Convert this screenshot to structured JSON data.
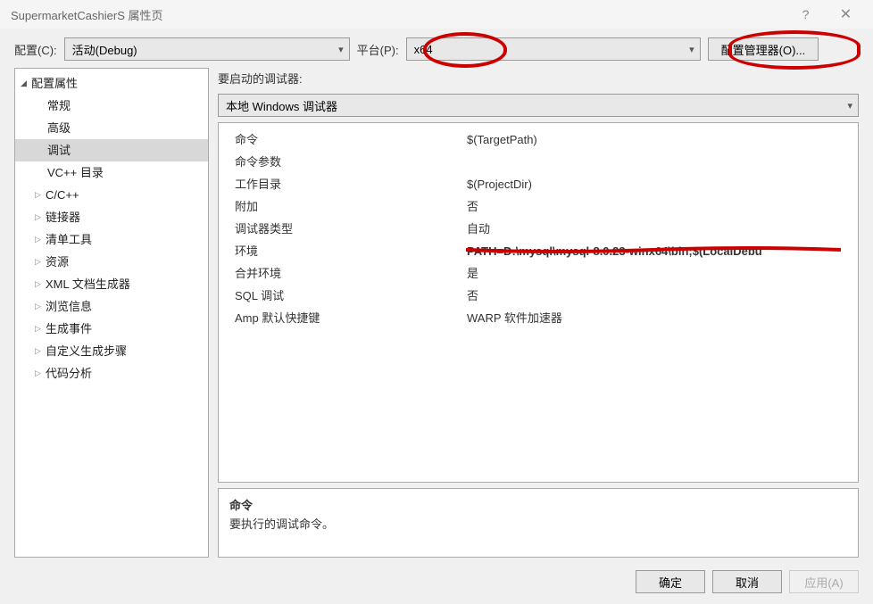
{
  "titlebar": {
    "text": "SupermarketCashierS 属性页",
    "help": "?",
    "close": "✕"
  },
  "toprow": {
    "config_label": "配置(C):",
    "config_value": "活动(Debug)",
    "platform_label": "平台(P):",
    "platform_value": "x64",
    "config_mgr": "配置管理器(O)..."
  },
  "tree": {
    "root": "配置属性",
    "items": [
      {
        "label": "常规",
        "exp": false
      },
      {
        "label": "高级",
        "exp": false
      },
      {
        "label": "调试",
        "exp": false,
        "selected": true
      },
      {
        "label": "VC++ 目录",
        "exp": false
      },
      {
        "label": "C/C++",
        "exp": true
      },
      {
        "label": "链接器",
        "exp": true
      },
      {
        "label": "清单工具",
        "exp": true
      },
      {
        "label": "资源",
        "exp": true
      },
      {
        "label": "XML 文档生成器",
        "exp": true
      },
      {
        "label": "浏览信息",
        "exp": true
      },
      {
        "label": "生成事件",
        "exp": true
      },
      {
        "label": "自定义生成步骤",
        "exp": true
      },
      {
        "label": "代码分析",
        "exp": true
      }
    ]
  },
  "right": {
    "debugger_label": "要启动的调试器:",
    "debugger_value": "本地 Windows 调试器",
    "grid": [
      {
        "k": "命令",
        "v": "$(TargetPath)"
      },
      {
        "k": "命令参数",
        "v": ""
      },
      {
        "k": "工作目录",
        "v": "$(ProjectDir)"
      },
      {
        "k": "附加",
        "v": "否"
      },
      {
        "k": "调试器类型",
        "v": "自动"
      },
      {
        "k": "环境",
        "v": "PATH=D:\\mysql\\mysql-8.0.23-winx64\\bin;$(LocalDebu",
        "bold": true
      },
      {
        "k": "合并环境",
        "v": "是"
      },
      {
        "k": "SQL 调试",
        "v": "否"
      },
      {
        "k": "Amp 默认快捷键",
        "v": "WARP 软件加速器"
      }
    ],
    "desc": {
      "title": "命令",
      "text": "要执行的调试命令。"
    }
  },
  "buttons": {
    "ok": "确定",
    "cancel": "取消",
    "apply": "应用(A)"
  }
}
